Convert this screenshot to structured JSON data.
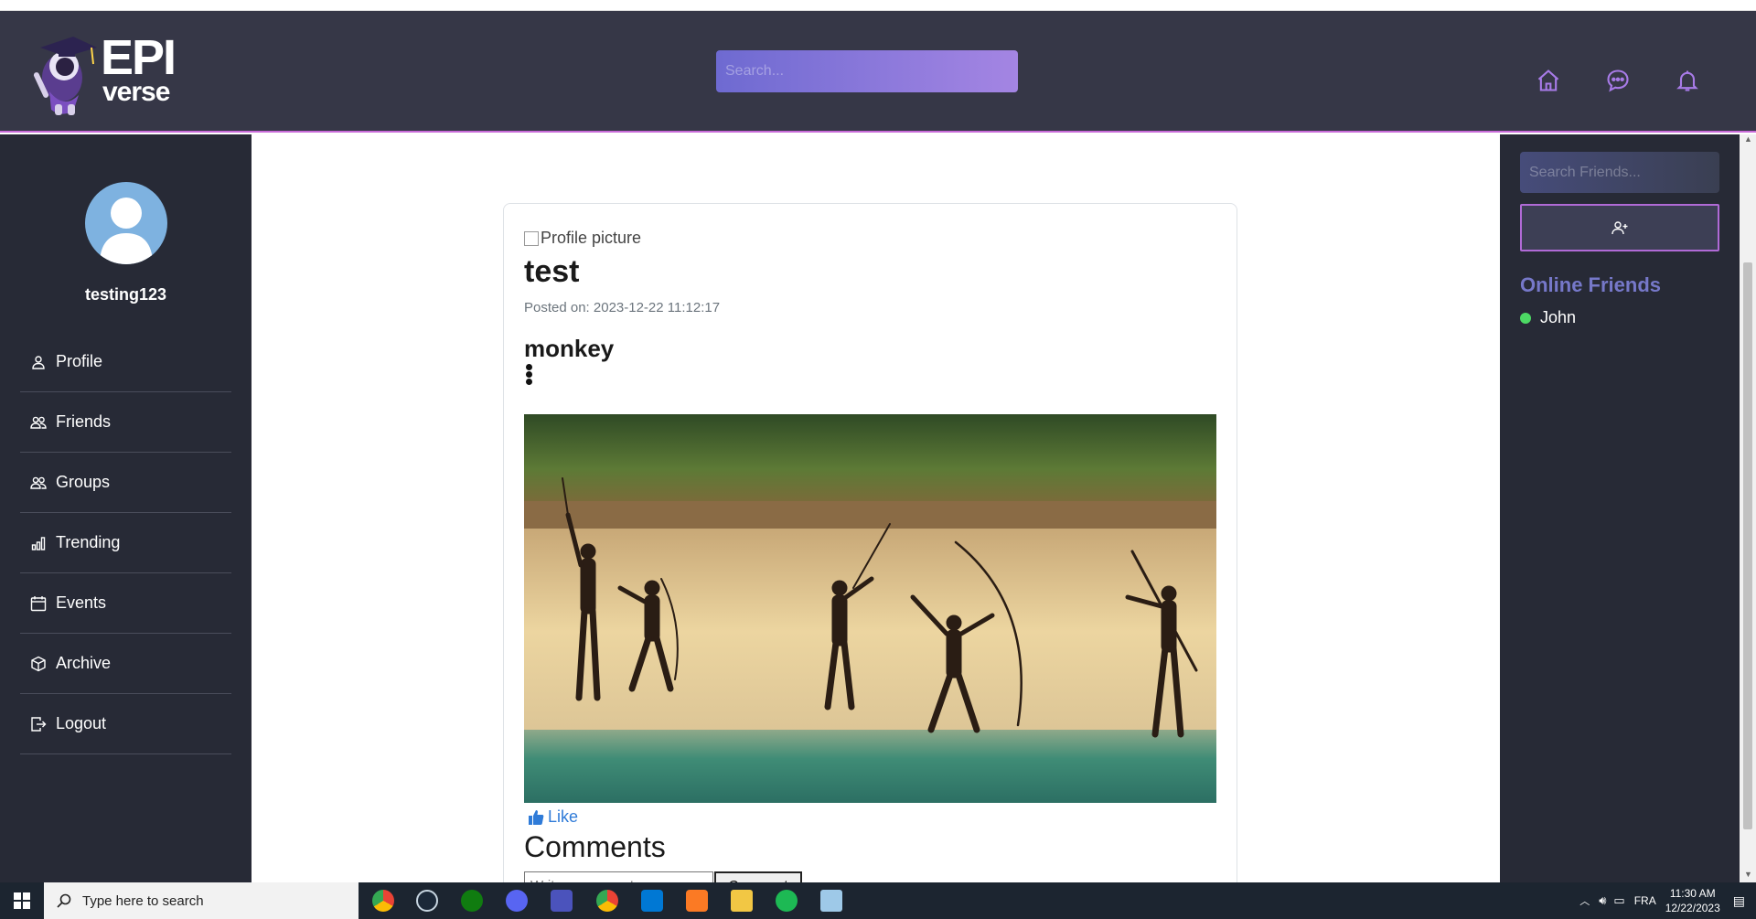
{
  "app": {
    "logo_text_top": "EPI",
    "logo_text_bottom": "verse"
  },
  "header": {
    "search_placeholder": "Search..."
  },
  "sidebar": {
    "username": "testing123",
    "items": [
      {
        "label": "Profile",
        "icon": "user-icon"
      },
      {
        "label": "Friends",
        "icon": "users-icon"
      },
      {
        "label": "Groups",
        "icon": "users-icon"
      },
      {
        "label": "Trending",
        "icon": "bar-chart-icon"
      },
      {
        "label": "Events",
        "icon": "calendar-icon"
      },
      {
        "label": "Archive",
        "icon": "box-icon"
      },
      {
        "label": "Logout",
        "icon": "logout-icon"
      }
    ]
  },
  "friends_panel": {
    "search_placeholder": "Search Friends...",
    "online_title": "Online Friends",
    "online": [
      {
        "name": "John",
        "status_color": "#4cd964"
      }
    ]
  },
  "post": {
    "profile_picture_alt": "Profile picture",
    "title": "test",
    "posted_on": "Posted on: 2023-12-22 11:12:17",
    "body": "monkey",
    "like_label": "Like",
    "comments_title": "Comments",
    "comment_placeholder": "Write a comment...",
    "comment_button": "Comment"
  },
  "taskbar": {
    "search_label": "Type here to search",
    "language": "FRA",
    "time": "11:30 AM",
    "date": "12/22/2023"
  },
  "colors": {
    "header_bg": "#363747",
    "sidebar_bg": "#272a36",
    "accent": "#c86bd8",
    "online_title": "#7678c9",
    "like": "#2f7bd8"
  }
}
